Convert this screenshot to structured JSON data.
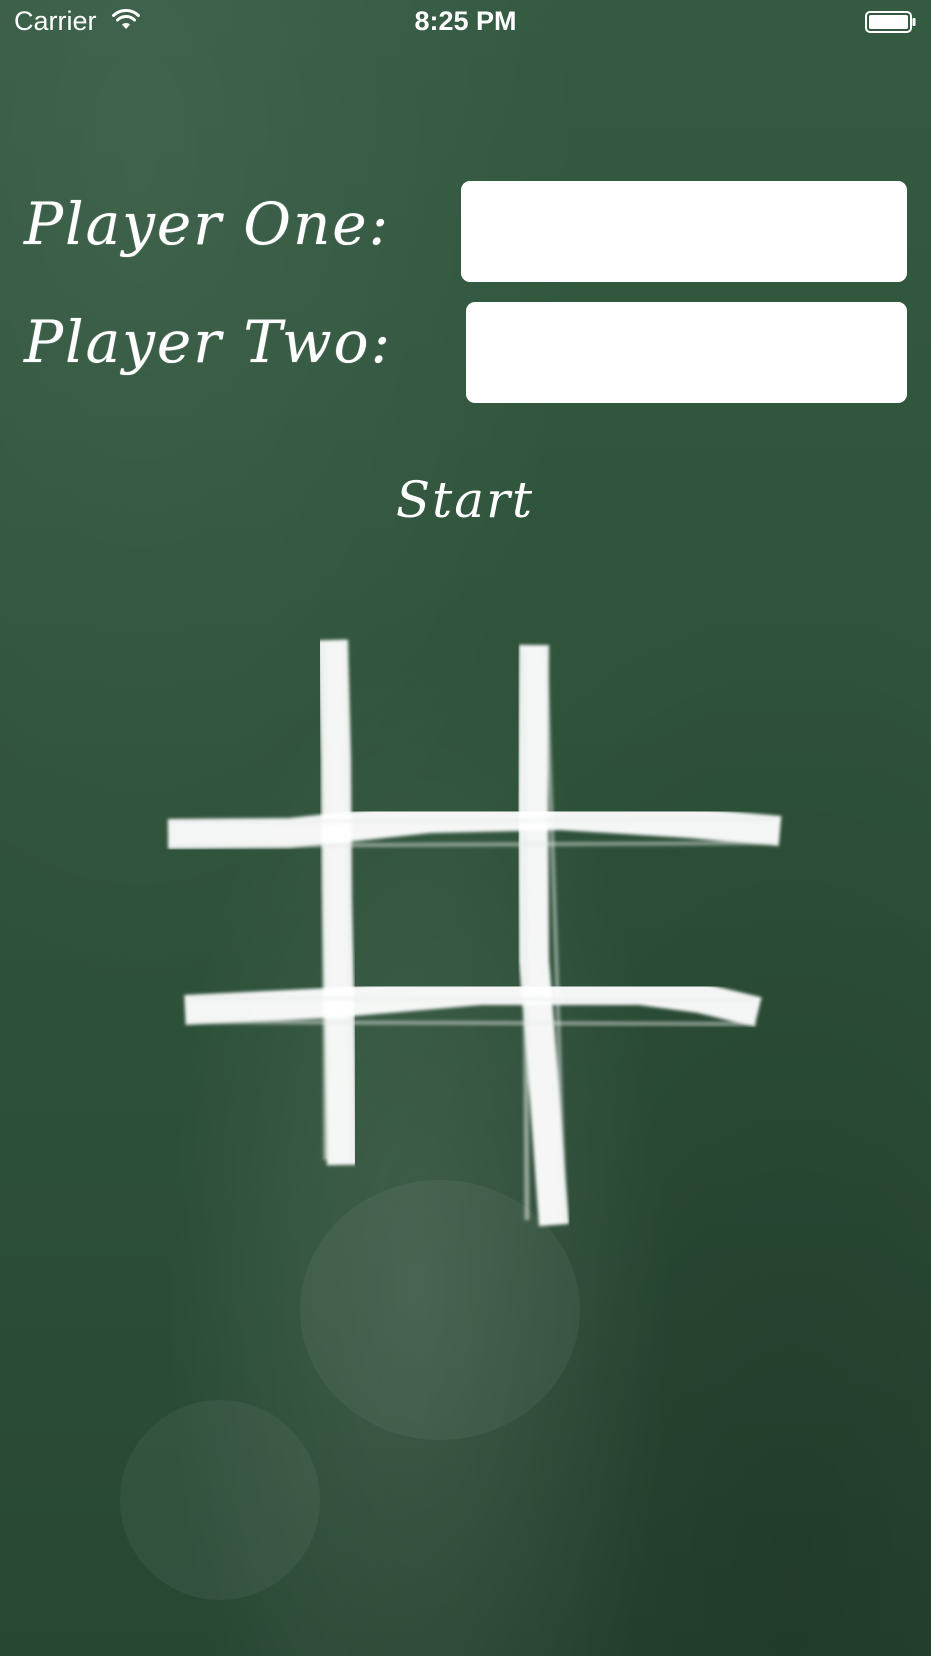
{
  "status_bar": {
    "carrier": "Carrier",
    "time": "8:25 PM",
    "wifi_icon": "wifi-icon",
    "battery_icon": "battery-icon"
  },
  "form": {
    "player_one_label": "Player One:",
    "player_two_label": "Player Two:",
    "player_one_value": "",
    "player_two_value": "",
    "start_label": "Start"
  },
  "board": {
    "rows": 3,
    "columns": 3,
    "cells": [
      "",
      "",
      "",
      "",
      "",
      "",
      "",
      "",
      ""
    ]
  },
  "colors": {
    "chalkboard": "#2f523b",
    "chalk": "#ffffff"
  }
}
